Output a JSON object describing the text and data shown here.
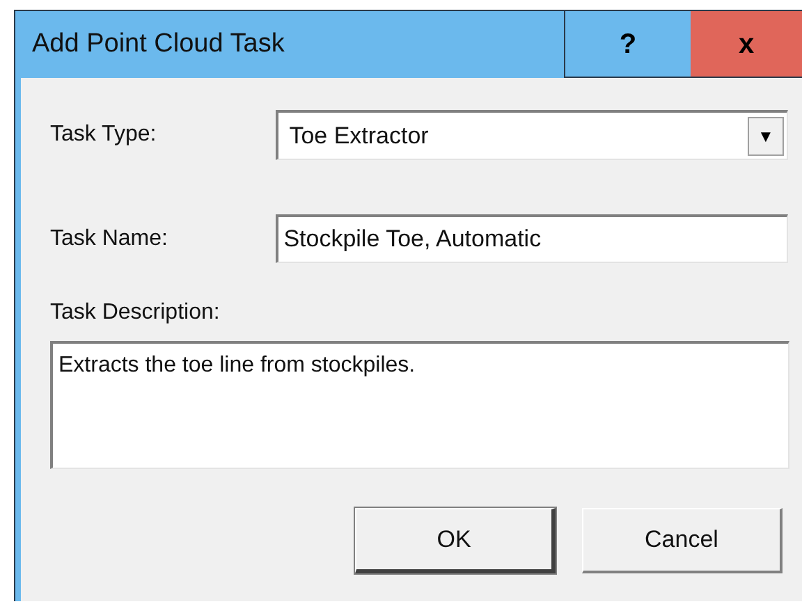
{
  "window": {
    "title": "Add Point Cloud Task",
    "help": "?",
    "close": "x"
  },
  "task_type": {
    "label": "Task Type:",
    "value": "Toe Extractor",
    "caret": "▼"
  },
  "task_name": {
    "label": "Task Name:",
    "value": "Stockpile Toe, Automatic"
  },
  "task_description": {
    "label": "Task Description:",
    "value": "Extracts the toe line from stockpiles."
  },
  "buttons": [
    {
      "label": "OK",
      "default": true
    },
    {
      "label": "Cancel",
      "default": false
    }
  ]
}
